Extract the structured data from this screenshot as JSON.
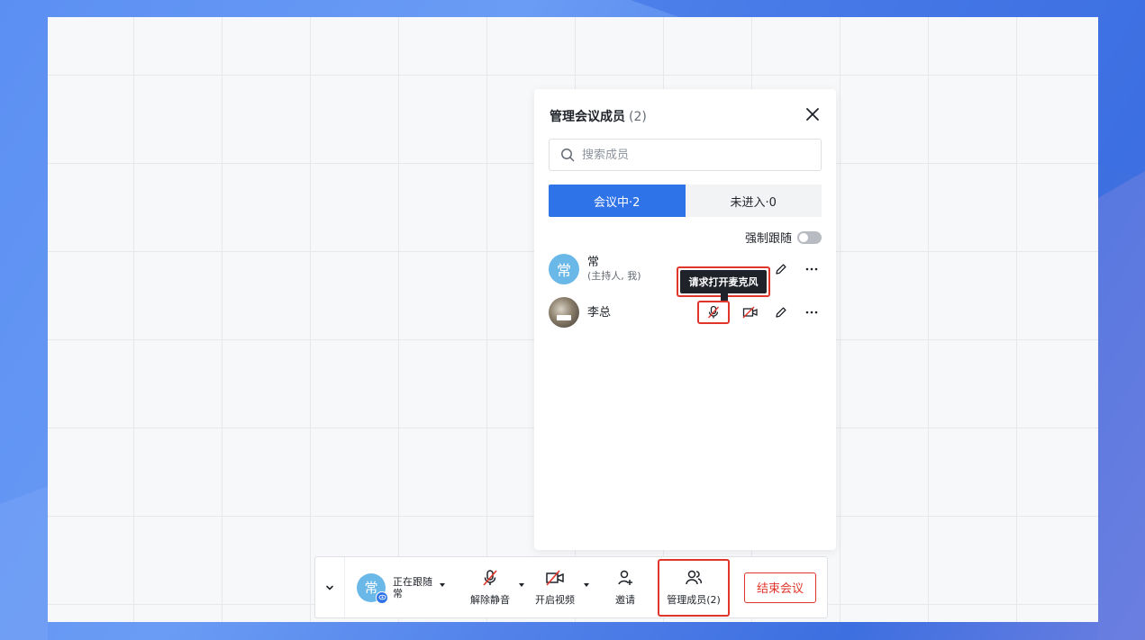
{
  "panel": {
    "title": "管理会议成员",
    "count": "(2)",
    "search_placeholder": "搜索成员",
    "tabs": [
      {
        "label": "会议中·2",
        "active": true
      },
      {
        "label": "未进入·0",
        "active": false
      }
    ],
    "force_follow_label": "强制跟随",
    "force_follow_on": false
  },
  "members": [
    {
      "avatar_text": "常",
      "name": "常",
      "sub": "(主持人, 我)"
    },
    {
      "avatar_text": "",
      "name": "李总",
      "sub": ""
    }
  ],
  "tooltip": {
    "text": "请求打开麦克风"
  },
  "toolbar": {
    "follow_status": "正在跟随",
    "follow_name": "常",
    "avatar_text": "常",
    "unmute_label": "解除静音",
    "video_label": "开启视频",
    "invite_label": "邀请",
    "manage_label": "管理成员(2)",
    "end_label": "结束会议"
  },
  "colors": {
    "accent": "#2f73e8",
    "danger": "#e0352b",
    "avatar": "#6ab8e8"
  },
  "icons": [
    "close-icon",
    "search-icon",
    "mic-off-icon",
    "video-off-icon",
    "edit-icon",
    "more-icon",
    "chevron-down-icon",
    "eye-icon",
    "invite-icon",
    "members-icon"
  ]
}
